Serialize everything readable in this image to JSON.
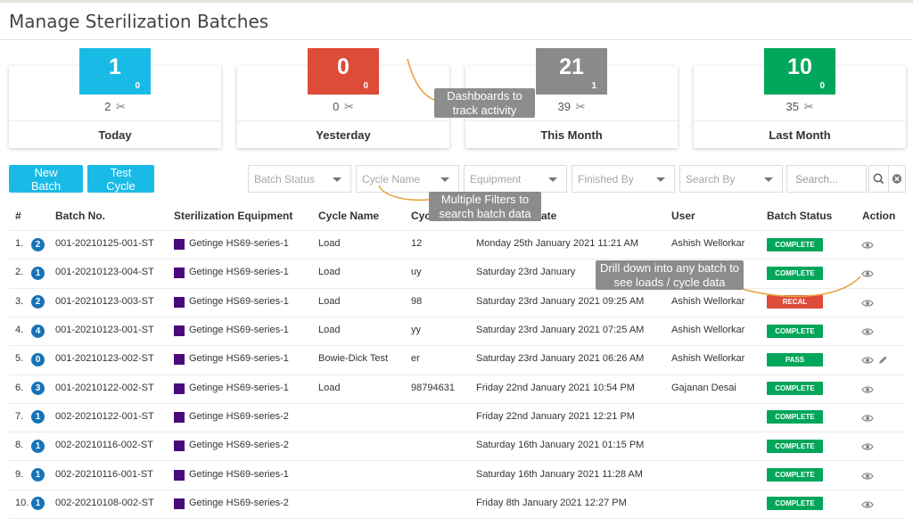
{
  "page": {
    "title": "Manage Sterilization Batches"
  },
  "stats": [
    {
      "label": "Today",
      "count": "1",
      "sub": "0",
      "loads": "2",
      "color": "#19bbe6"
    },
    {
      "label": "Yesterday",
      "count": "0",
      "sub": "0",
      "loads": "0",
      "color": "#dd4b39"
    },
    {
      "label": "This Month",
      "count": "21",
      "sub": "1",
      "loads": "39",
      "color": "#8a8a8a"
    },
    {
      "label": "Last Month",
      "count": "10",
      "sub": "0",
      "loads": "35",
      "color": "#00a65a"
    }
  ],
  "toolbar": {
    "new_batch": "New Batch",
    "test_cycle": "Test Cycle"
  },
  "filters": {
    "batch_status": "Batch Status",
    "cycle_name": "Cycle Name",
    "equipment": "Equipment",
    "finished_by": "Finished By",
    "search_by": "Search By",
    "search_placeholder": "Search..."
  },
  "table": {
    "headers": {
      "num": "#",
      "batch": "Batch No.",
      "equipment": "Sterilization Equipment",
      "cycle_name": "Cycle Name",
      "cycle": "Cyc",
      "date": "ate",
      "user": "User",
      "status": "Batch Status",
      "action": "Action"
    },
    "rows": [
      {
        "idx": "1.",
        "count": "2",
        "batch": "001-20210125-001-ST",
        "equipment": "Getinge HS69-series-1",
        "cycle_name": "Load",
        "cycle": "12",
        "date": "Monday 25th January 2021 11:21 AM",
        "user": "Ashish Wellorkar",
        "status": "COMPLETE"
      },
      {
        "idx": "2.",
        "count": "1",
        "batch": "001-20210123-004-ST",
        "equipment": "Getinge HS69-series-1",
        "cycle_name": "Load",
        "cycle": "uy",
        "date": "Saturday 23rd January",
        "user": "",
        "status": "COMPLETE"
      },
      {
        "idx": "3.",
        "count": "2",
        "batch": "001-20210123-003-ST",
        "equipment": "Getinge HS69-series-1",
        "cycle_name": "Load",
        "cycle": "98",
        "date": "Saturday 23rd January 2021 09:25 AM",
        "user": "Ashish Wellorkar",
        "status": "RECAL"
      },
      {
        "idx": "4.",
        "count": "4",
        "batch": "001-20210123-001-ST",
        "equipment": "Getinge HS69-series-1",
        "cycle_name": "Load",
        "cycle": "yy",
        "date": "Saturday 23rd January 2021 07:25 AM",
        "user": "Ashish Wellorkar",
        "status": "COMPLETE"
      },
      {
        "idx": "5.",
        "count": "0",
        "batch": "001-20210123-002-ST",
        "equipment": "Getinge HS69-series-1",
        "cycle_name": "Bowie-Dick Test",
        "cycle": "er",
        "date": "Saturday 23rd January 2021 06:26 AM",
        "user": "Ashish Wellorkar",
        "status": "PASS"
      },
      {
        "idx": "6.",
        "count": "3",
        "batch": "001-20210122-002-ST",
        "equipment": "Getinge HS69-series-1",
        "cycle_name": "Load",
        "cycle": "98794631",
        "date": "Friday 22nd January 2021 10:54 PM",
        "user": "Gajanan Desai",
        "status": "COMPLETE"
      },
      {
        "idx": "7.",
        "count": "1",
        "batch": "002-20210122-001-ST",
        "equipment": "Getinge HS69-series-2",
        "cycle_name": "",
        "cycle": "",
        "date": "Friday 22nd January 2021 12:21 PM",
        "user": "",
        "status": "COMPLETE"
      },
      {
        "idx": "8.",
        "count": "1",
        "batch": "002-20210116-002-ST",
        "equipment": "Getinge HS69-series-2",
        "cycle_name": "",
        "cycle": "",
        "date": "Saturday 16th January 2021 01:15 PM",
        "user": "",
        "status": "COMPLETE"
      },
      {
        "idx": "9.",
        "count": "1",
        "batch": "002-20210116-001-ST",
        "equipment": "Getinge HS69-series-1",
        "cycle_name": "",
        "cycle": "",
        "date": "Saturday 16th January 2021 11:28 AM",
        "user": "",
        "status": "COMPLETE"
      },
      {
        "idx": "10.",
        "count": "1",
        "batch": "002-20210108-002-ST",
        "equipment": "Getinge HS69-series-2",
        "cycle_name": "",
        "cycle": "",
        "date": "Friday 8th January 2021 12:27 PM",
        "user": "",
        "status": "COMPLETE"
      }
    ]
  },
  "status_colors": {
    "COMPLETE": "#00a65a",
    "PASS": "#00a65a",
    "RECAL": "#dd4b39"
  },
  "callouts": {
    "dashboards": "Dashboards to track activity",
    "filters": "Multiple Filters to search batch data",
    "drilldown": "Drill down into any batch to see loads / cycle data"
  },
  "icons": {
    "loads": "scissors-icon",
    "view": "eye-icon",
    "edit": "pencil-icon",
    "search": "search-icon",
    "clear": "close-circle-icon"
  }
}
